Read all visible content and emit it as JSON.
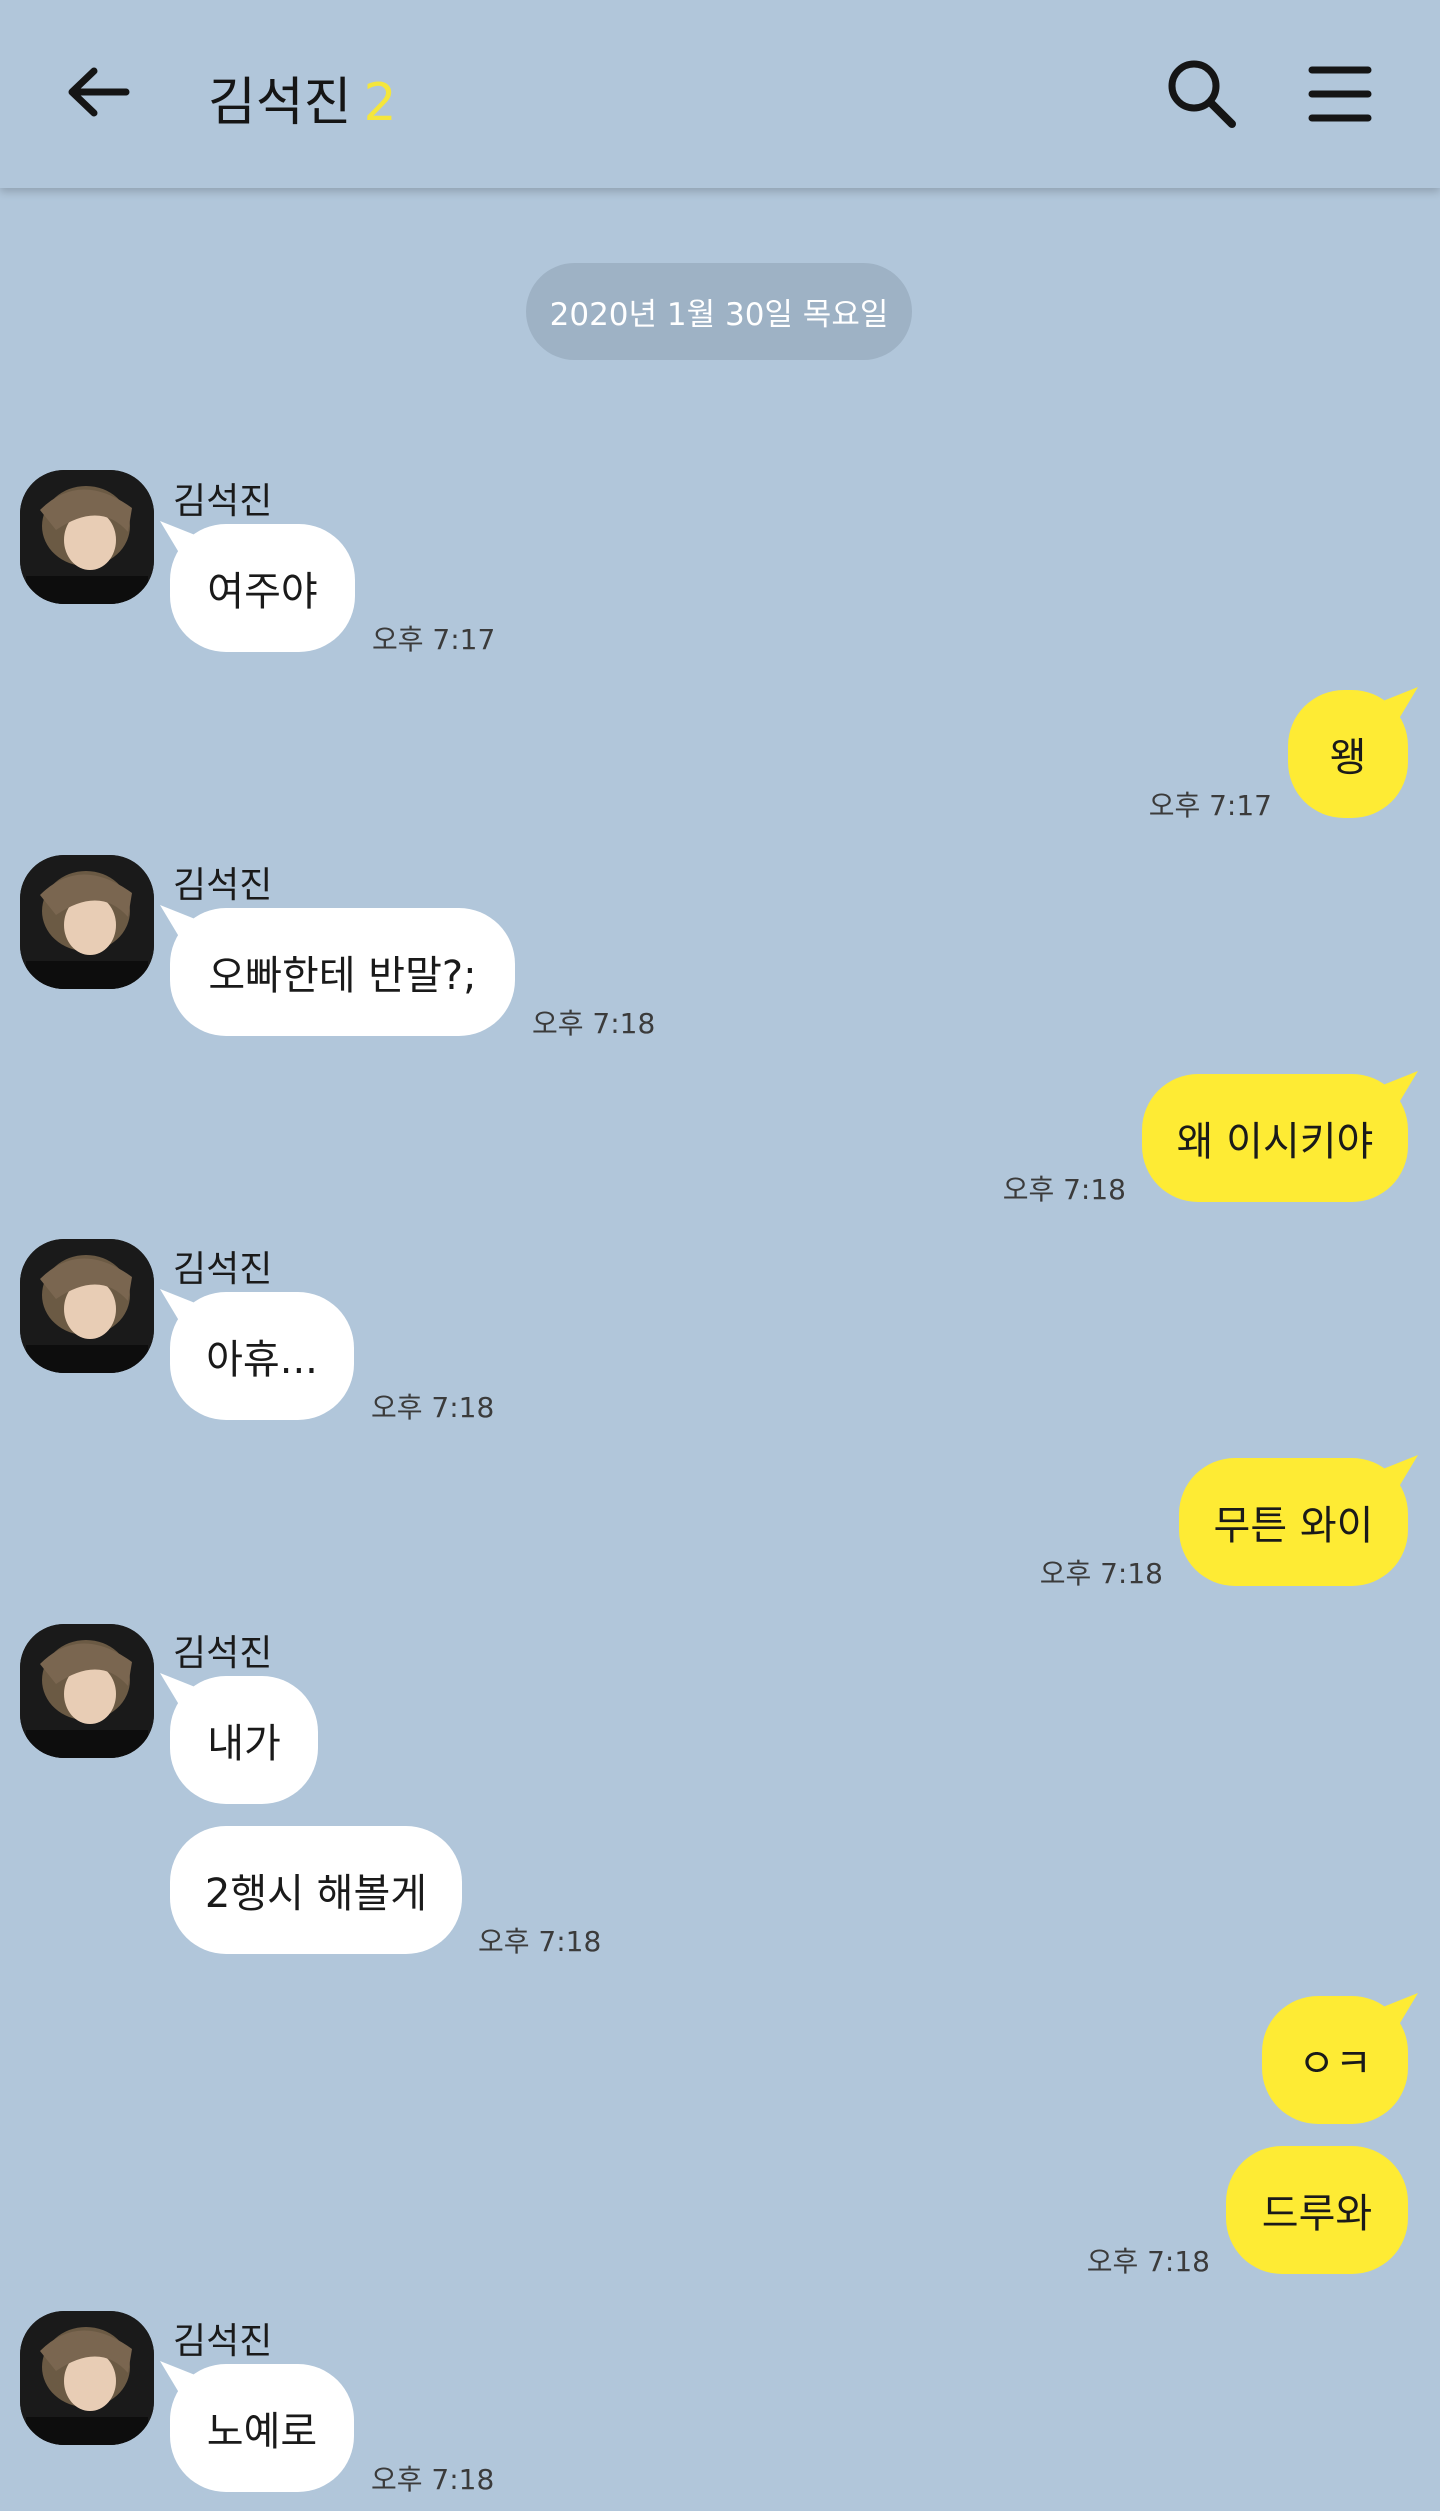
{
  "header": {
    "title": "김석진",
    "member_count": "2",
    "back_icon": "arrow-left-icon",
    "search_icon": "search-icon",
    "menu_icon": "hamburger-menu-icon"
  },
  "date_divider": "2020년 1월 30일 목요일",
  "messages": [
    {
      "sender": "김석진",
      "text": "여주야",
      "time": "오후 7:17"
    },
    {
      "text": "왱",
      "time": "오후 7:17"
    },
    {
      "sender": "김석진",
      "text": "오빠한테 반말?;",
      "time": "오후 7:18"
    },
    {
      "text": "왜 이시키야",
      "time": "오후 7:18"
    },
    {
      "sender": "김석진",
      "text": "아휴...",
      "time": "오후 7:18"
    },
    {
      "text": "무튼 와이",
      "time": "오후 7:18"
    },
    {
      "sender": "김석진",
      "text": "내가"
    },
    {
      "text": "2행시 해볼게",
      "time": "오후 7:18"
    },
    {
      "text": "ㅇㅋ"
    },
    {
      "text": "드루와",
      "time": "오후 7:18"
    },
    {
      "sender": "김석진",
      "text": "노예로",
      "time": "오후 7:18"
    }
  ],
  "colors": {
    "background": "#b1c6da",
    "outgoing_bubble": "#feeb34",
    "incoming_bubble": "#ffffff",
    "member_count": "#f5e63c"
  }
}
